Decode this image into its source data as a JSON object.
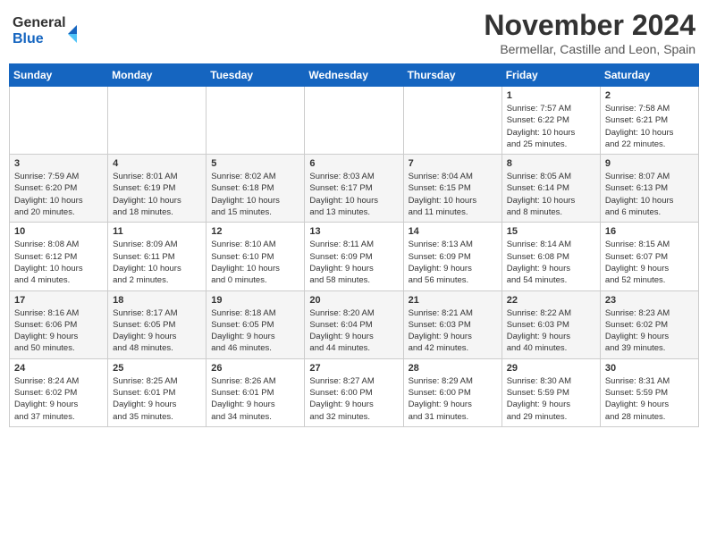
{
  "header": {
    "logo_line1": "General",
    "logo_line2": "Blue",
    "month": "November 2024",
    "location": "Bermellar, Castille and Leon, Spain"
  },
  "weekdays": [
    "Sunday",
    "Monday",
    "Tuesday",
    "Wednesday",
    "Thursday",
    "Friday",
    "Saturday"
  ],
  "weeks": [
    {
      "row": 1,
      "days": [
        {
          "date": "",
          "info": ""
        },
        {
          "date": "",
          "info": ""
        },
        {
          "date": "",
          "info": ""
        },
        {
          "date": "",
          "info": ""
        },
        {
          "date": "",
          "info": ""
        },
        {
          "date": "1",
          "info": "Sunrise: 7:57 AM\nSunset: 6:22 PM\nDaylight: 10 hours\nand 25 minutes."
        },
        {
          "date": "2",
          "info": "Sunrise: 7:58 AM\nSunset: 6:21 PM\nDaylight: 10 hours\nand 22 minutes."
        }
      ]
    },
    {
      "row": 2,
      "days": [
        {
          "date": "3",
          "info": "Sunrise: 7:59 AM\nSunset: 6:20 PM\nDaylight: 10 hours\nand 20 minutes."
        },
        {
          "date": "4",
          "info": "Sunrise: 8:01 AM\nSunset: 6:19 PM\nDaylight: 10 hours\nand 18 minutes."
        },
        {
          "date": "5",
          "info": "Sunrise: 8:02 AM\nSunset: 6:18 PM\nDaylight: 10 hours\nand 15 minutes."
        },
        {
          "date": "6",
          "info": "Sunrise: 8:03 AM\nSunset: 6:17 PM\nDaylight: 10 hours\nand 13 minutes."
        },
        {
          "date": "7",
          "info": "Sunrise: 8:04 AM\nSunset: 6:15 PM\nDaylight: 10 hours\nand 11 minutes."
        },
        {
          "date": "8",
          "info": "Sunrise: 8:05 AM\nSunset: 6:14 PM\nDaylight: 10 hours\nand 8 minutes."
        },
        {
          "date": "9",
          "info": "Sunrise: 8:07 AM\nSunset: 6:13 PM\nDaylight: 10 hours\nand 6 minutes."
        }
      ]
    },
    {
      "row": 3,
      "days": [
        {
          "date": "10",
          "info": "Sunrise: 8:08 AM\nSunset: 6:12 PM\nDaylight: 10 hours\nand 4 minutes."
        },
        {
          "date": "11",
          "info": "Sunrise: 8:09 AM\nSunset: 6:11 PM\nDaylight: 10 hours\nand 2 minutes."
        },
        {
          "date": "12",
          "info": "Sunrise: 8:10 AM\nSunset: 6:10 PM\nDaylight: 10 hours\nand 0 minutes."
        },
        {
          "date": "13",
          "info": "Sunrise: 8:11 AM\nSunset: 6:09 PM\nDaylight: 9 hours\nand 58 minutes."
        },
        {
          "date": "14",
          "info": "Sunrise: 8:13 AM\nSunset: 6:09 PM\nDaylight: 9 hours\nand 56 minutes."
        },
        {
          "date": "15",
          "info": "Sunrise: 8:14 AM\nSunset: 6:08 PM\nDaylight: 9 hours\nand 54 minutes."
        },
        {
          "date": "16",
          "info": "Sunrise: 8:15 AM\nSunset: 6:07 PM\nDaylight: 9 hours\nand 52 minutes."
        }
      ]
    },
    {
      "row": 4,
      "days": [
        {
          "date": "17",
          "info": "Sunrise: 8:16 AM\nSunset: 6:06 PM\nDaylight: 9 hours\nand 50 minutes."
        },
        {
          "date": "18",
          "info": "Sunrise: 8:17 AM\nSunset: 6:05 PM\nDaylight: 9 hours\nand 48 minutes."
        },
        {
          "date": "19",
          "info": "Sunrise: 8:18 AM\nSunset: 6:05 PM\nDaylight: 9 hours\nand 46 minutes."
        },
        {
          "date": "20",
          "info": "Sunrise: 8:20 AM\nSunset: 6:04 PM\nDaylight: 9 hours\nand 44 minutes."
        },
        {
          "date": "21",
          "info": "Sunrise: 8:21 AM\nSunset: 6:03 PM\nDaylight: 9 hours\nand 42 minutes."
        },
        {
          "date": "22",
          "info": "Sunrise: 8:22 AM\nSunset: 6:03 PM\nDaylight: 9 hours\nand 40 minutes."
        },
        {
          "date": "23",
          "info": "Sunrise: 8:23 AM\nSunset: 6:02 PM\nDaylight: 9 hours\nand 39 minutes."
        }
      ]
    },
    {
      "row": 5,
      "days": [
        {
          "date": "24",
          "info": "Sunrise: 8:24 AM\nSunset: 6:02 PM\nDaylight: 9 hours\nand 37 minutes."
        },
        {
          "date": "25",
          "info": "Sunrise: 8:25 AM\nSunset: 6:01 PM\nDaylight: 9 hours\nand 35 minutes."
        },
        {
          "date": "26",
          "info": "Sunrise: 8:26 AM\nSunset: 6:01 PM\nDaylight: 9 hours\nand 34 minutes."
        },
        {
          "date": "27",
          "info": "Sunrise: 8:27 AM\nSunset: 6:00 PM\nDaylight: 9 hours\nand 32 minutes."
        },
        {
          "date": "28",
          "info": "Sunrise: 8:29 AM\nSunset: 6:00 PM\nDaylight: 9 hours\nand 31 minutes."
        },
        {
          "date": "29",
          "info": "Sunrise: 8:30 AM\nSunset: 5:59 PM\nDaylight: 9 hours\nand 29 minutes."
        },
        {
          "date": "30",
          "info": "Sunrise: 8:31 AM\nSunset: 5:59 PM\nDaylight: 9 hours\nand 28 minutes."
        }
      ]
    }
  ]
}
